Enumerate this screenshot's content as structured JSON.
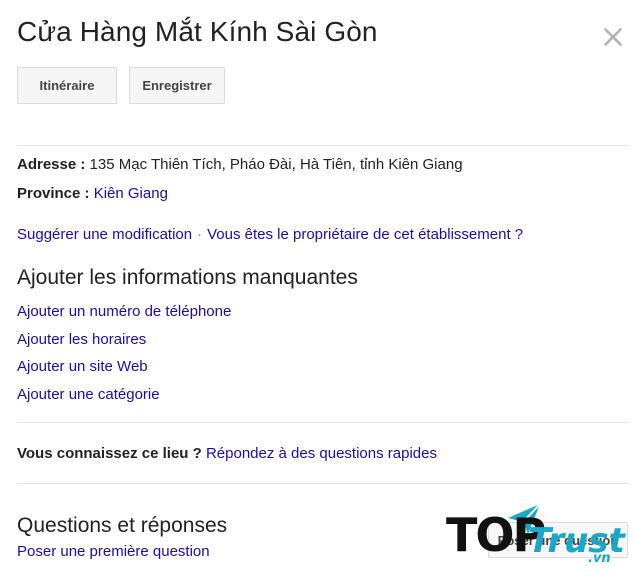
{
  "place": {
    "title": "Cửa Hàng Mắt Kính Sài Gòn"
  },
  "actions": {
    "directions_label": "Itinéraire",
    "save_label": "Enregistrer"
  },
  "details": {
    "address_label": "Adresse :",
    "address_value": "135 Mạc Thiên Tích, Pháo Đài, Hà Tiên, tỉnh Kiên Giang",
    "province_label": "Province :",
    "province_value": "Kiên Giang"
  },
  "edit_links": {
    "suggest_edit": "Suggérer une modification",
    "separator": "·",
    "owner": "Vous êtes le propriétaire de cet établissement ?"
  },
  "missing_info": {
    "heading": "Ajouter les informations manquantes",
    "items": [
      "Ajouter un numéro de téléphone",
      "Ajouter les horaires",
      "Ajouter un site Web",
      "Ajouter une catégorie"
    ]
  },
  "know_place": {
    "question": "Vous connaissez ce lieu ?",
    "answer_link": "Répondez à des questions rapides"
  },
  "qa": {
    "heading": "Questions et réponses",
    "first_question_link": "Poser une première question",
    "ask_button": "Poser une question"
  },
  "watermark": {
    "top_text": "TOP",
    "trust_text": "Trust",
    "domain_text": ".vn",
    "accent_color": "#1aa8c8"
  },
  "icons": {
    "close": "close-icon"
  },
  "colors": {
    "link": "#1a0dab",
    "text": "#222222",
    "button_bg": "#f5f5f5",
    "divider": "#e6e6e6"
  }
}
